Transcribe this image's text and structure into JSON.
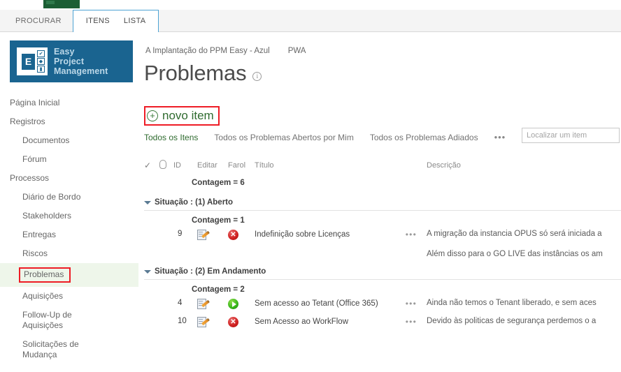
{
  "suite": {
    "app_tile": "office-tile"
  },
  "ribbon": {
    "tabs": [
      {
        "label": "PROCURAR",
        "selected": false
      },
      {
        "label": "ITENS",
        "selected": true
      },
      {
        "label": "LISTA",
        "selected": true
      }
    ]
  },
  "logo": {
    "letter": "E",
    "line1": "Easy",
    "line2": "Project",
    "line3": "Management",
    "chips": [
      "✔",
      "◆",
      "▮"
    ],
    "bg_color": "#1a6490"
  },
  "sidebar": {
    "items": [
      {
        "label": "Página Inicial",
        "child": false,
        "selected": false
      },
      {
        "label": "Registros",
        "child": false,
        "selected": false
      },
      {
        "label": "Documentos",
        "child": true,
        "selected": false
      },
      {
        "label": "Fórum",
        "child": true,
        "selected": false
      },
      {
        "label": "Processos",
        "child": false,
        "selected": false
      },
      {
        "label": "Diário de Bordo",
        "child": true,
        "selected": false
      },
      {
        "label": "Stakeholders",
        "child": true,
        "selected": false
      },
      {
        "label": "Entregas",
        "child": true,
        "selected": false
      },
      {
        "label": "Riscos",
        "child": true,
        "selected": false
      },
      {
        "label": "Problemas",
        "child": true,
        "selected": true
      },
      {
        "label": "Aquisições",
        "child": true,
        "selected": false
      },
      {
        "label": "Follow-Up de\nAquisições",
        "child": true,
        "selected": false
      },
      {
        "label": "Solicitações de\nMudança",
        "child": true,
        "selected": false
      }
    ],
    "selected_highlight_color": "#eef6ea",
    "selected_outline_color": "#ee1c25"
  },
  "header": {
    "breadcrumb": [
      "A Implantação do PPM Easy - Azul",
      "PWA"
    ],
    "title": "Problemas",
    "info_icon": "info-icon"
  },
  "toolbar": {
    "new_item_label": "novo item",
    "new_item_icon": "plus-circle-icon",
    "new_item_outline_color": "#ee1c25"
  },
  "views": {
    "tabs": [
      {
        "label": "Todos os Itens",
        "active": true
      },
      {
        "label": "Todos os Problemas Abertos por Mim",
        "active": false
      },
      {
        "label": "Todos os Problemas Adiados",
        "active": false
      }
    ],
    "ellipsis": "•••"
  },
  "search": {
    "placeholder": "Localizar um item",
    "value": ""
  },
  "list": {
    "columns": {
      "check": "✓",
      "attach": "attachment-icon",
      "id": "ID",
      "edit": "Editar",
      "farol": "Farol",
      "title": "Título",
      "desc": "Descrição"
    },
    "total_count_label": "Contagem = 6",
    "groups": [
      {
        "header": "Situação : (1) Aberto",
        "count_label": "Contagem = 1",
        "rows": [
          {
            "id": "9",
            "edit_icon": "edit-item-icon",
            "farol": "red",
            "farol_icon": "status-red-x-icon",
            "title": "Indefinição sobre Licenças",
            "row_menu": "•••",
            "desc_lines": [
              "A migração da instancia OPUS só será iniciada a",
              "Além disso para o GO LIVE das instâncias os am"
            ]
          }
        ]
      },
      {
        "header": "Situação : (2) Em Andamento",
        "count_label": "Contagem = 2",
        "rows": [
          {
            "id": "4",
            "edit_icon": "edit-item-icon",
            "farol": "green",
            "farol_icon": "status-green-play-icon",
            "title": "Sem acesso ao Tetant (Office 365)",
            "row_menu": "•••",
            "desc_lines": [
              "Ainda não temos o Tenant liberado, e sem aces"
            ]
          },
          {
            "id": "10",
            "edit_icon": "edit-item-icon",
            "farol": "red",
            "farol_icon": "status-red-x-icon",
            "title": "Sem Acesso ao WorkFlow",
            "row_menu": "•••",
            "desc_lines": [
              "Devido às politicas de segurança perdemos o a"
            ]
          }
        ]
      }
    ]
  }
}
